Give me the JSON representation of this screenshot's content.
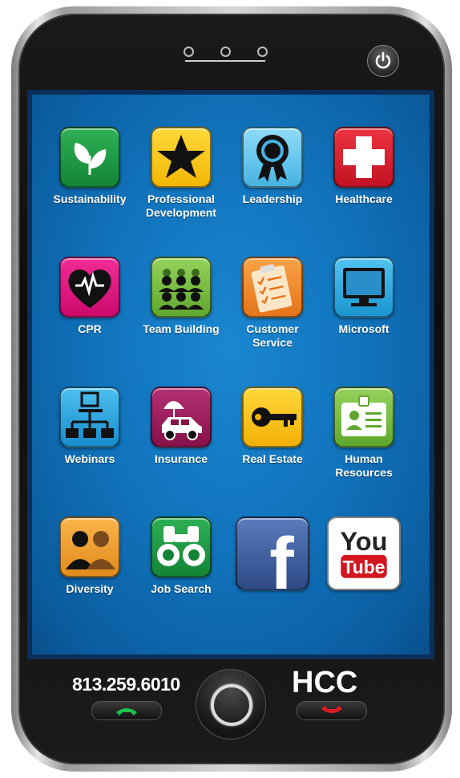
{
  "apps": [
    {
      "label": "Sustainability",
      "color": "#1a8f3c",
      "icon": "leaf-icon"
    },
    {
      "label": "Professional Development",
      "color": "#f7c40c",
      "icon": "star-icon"
    },
    {
      "label": "Leadership",
      "color": "#5ec3ea",
      "icon": "ribbon-award-icon"
    },
    {
      "label": "Healthcare",
      "color": "#d8202e",
      "icon": "medical-cross-icon"
    },
    {
      "label": "CPR",
      "color": "#e3117f",
      "icon": "heart-pulse-icon"
    },
    {
      "label": "Team Building",
      "color": "#7cc045",
      "icon": "team-people-icon"
    },
    {
      "label": "Customer Service",
      "color": "#f28a24",
      "icon": "clipboard-checklist-icon"
    },
    {
      "label": "Microsoft",
      "color": "#27a9e0",
      "icon": "monitor-icon"
    },
    {
      "label": "Webinars",
      "color": "#1ea0dc",
      "icon": "network-icon"
    },
    {
      "label": "Insurance",
      "color": "#9b1f5e",
      "icon": "umbrella-car-icon"
    },
    {
      "label": "Real Estate",
      "color": "#f6c10f",
      "icon": "key-icon"
    },
    {
      "label": "Human Resources",
      "color": "#7dc142",
      "icon": "id-badge-icon"
    },
    {
      "label": "Diversity",
      "color": "#f1a233",
      "icon": "people-pair-icon"
    },
    {
      "label": "Job Search",
      "color": "#1a8f3c",
      "icon": "binoculars-icon"
    },
    {
      "label": "",
      "color": "#3b5998",
      "icon": "facebook-icon",
      "glyph": "f"
    },
    {
      "label": "",
      "color": "#ffffff",
      "icon": "youtube-icon",
      "glyph_top": "You",
      "glyph_bottom": "Tube"
    }
  ],
  "footer": {
    "phone_number": "813.259.6010",
    "brand": "HCC"
  }
}
